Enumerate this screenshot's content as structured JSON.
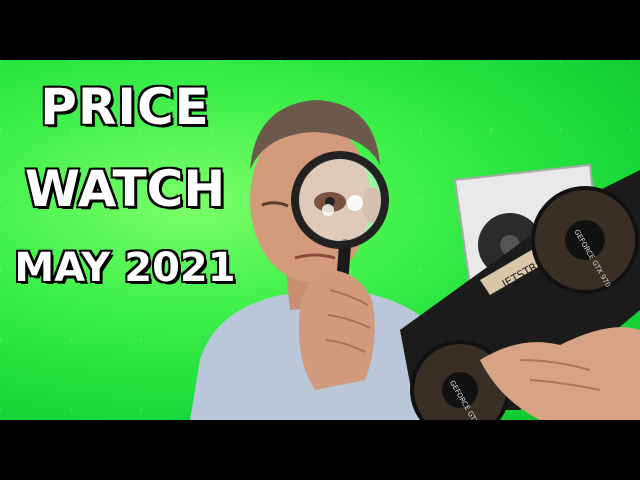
{
  "thumbnail": {
    "title_line1": "PRICE",
    "title_line2": "WATCH",
    "title_line3": "MAY 2021"
  },
  "colors": {
    "background_green": "#2fe83f",
    "text": "#ffffff",
    "text_outline": "#000000"
  },
  "graphics_card": {
    "brand_text": "JETSTREAM",
    "fan_label": "GEFORCE GTX 970"
  },
  "icons": [
    "magnifying-glass-icon"
  ]
}
